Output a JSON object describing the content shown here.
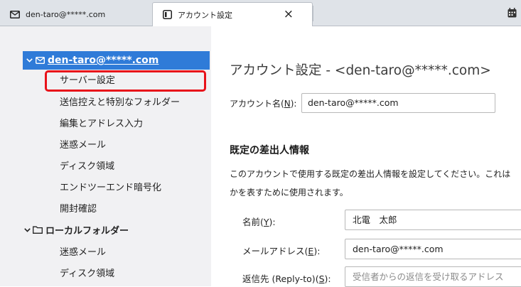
{
  "tabs": [
    {
      "label": "den-taro@*****.com",
      "icon": "mail-icon"
    },
    {
      "label": "アカウント設定",
      "icon": "settings-window-icon",
      "close": "×"
    }
  ],
  "sidebar": {
    "account": {
      "label": "den-taro@*****.com"
    },
    "account_items": [
      "サーバー設定",
      "送信控えと特別なフォルダー",
      "編集とアドレス入力",
      "迷惑メール",
      "ディスク領域",
      "エンドツーエンド暗号化",
      "開封確認"
    ],
    "local": {
      "label": "ローカルフォルダー"
    },
    "local_items": [
      "迷惑メール",
      "ディスク領域"
    ]
  },
  "main": {
    "title": "アカウント設定 - <den-taro@*****.com>",
    "account_name": {
      "label": "アカウント名",
      "accesskey": "N",
      "value": "den-taro@*****.com"
    },
    "section": "既定の差出人情報",
    "description_line1": "このアカウントで使用する既定の差出人情報を設定してください。これは",
    "description_line2": "かを表すために使用されます。",
    "fields": [
      {
        "label": "名前",
        "accesskey": "Y",
        "value": "北電　太郎",
        "placeholder": ""
      },
      {
        "label": "メールアドレス",
        "accesskey": "E",
        "value": "den-taro@*****.com",
        "placeholder": ""
      },
      {
        "label": "返信先 (Reply-to)",
        "accesskey": "S",
        "value": "",
        "placeholder": "受信者からの返信を受け取るアドレス"
      }
    ]
  },
  "colors": {
    "selection": "#2f7bd8",
    "highlight_border": "#e8121a",
    "sidebar_bg": "#f1f1f3"
  }
}
